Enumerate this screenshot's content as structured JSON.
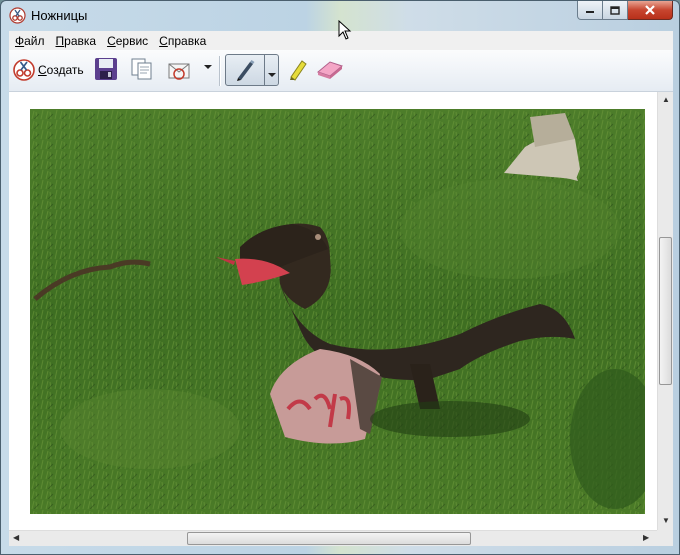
{
  "window": {
    "title": "Ножницы"
  },
  "menu": {
    "items": [
      {
        "label": "Файл",
        "accel": "Ф",
        "rest": "айл"
      },
      {
        "label": "Правка",
        "accel": "П",
        "rest": "равка"
      },
      {
        "label": "Сервис",
        "accel": "С",
        "rest": "ервис"
      },
      {
        "label": "Справка",
        "accel": "С",
        "rest": "правка"
      }
    ]
  },
  "toolbar": {
    "new_label": "Создать",
    "new_accel": "С",
    "new_rest": "оздать",
    "tools": [
      "scissors-icon",
      "save-icon",
      "copy-icon",
      "send-email-icon",
      "pen-icon",
      "highlighter-icon",
      "eraser-icon"
    ]
  },
  "canvas": {
    "content": "photo-snake-sculpture"
  },
  "colors": {
    "accent": "#c7452f",
    "canvas_bg": "#ffffff",
    "grass": "#3f6b22"
  }
}
